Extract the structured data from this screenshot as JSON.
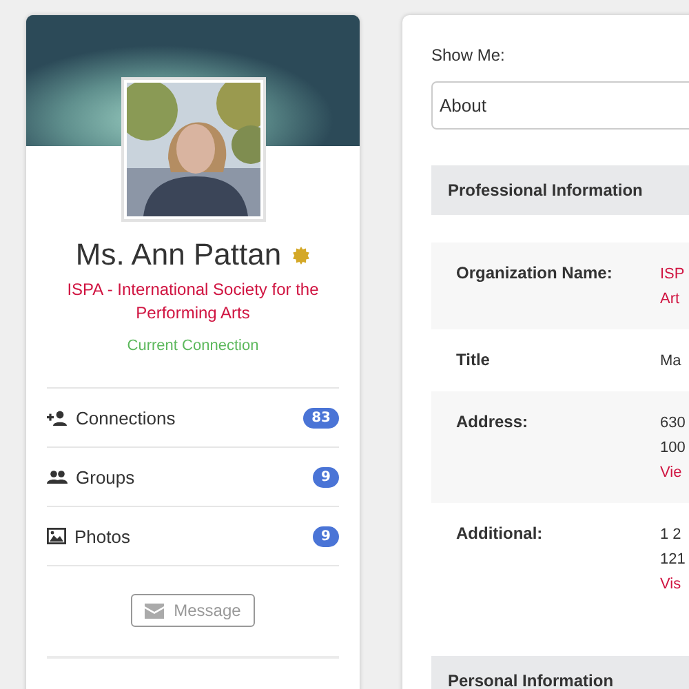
{
  "profile": {
    "name": "Ms. Ann Pattan",
    "organization": "ISPA - International Society for the Performing Arts",
    "status": "Current Connection"
  },
  "stats": [
    {
      "kind": "connections",
      "label": "Connections",
      "count": "83"
    },
    {
      "kind": "groups",
      "label": "Groups",
      "count": "9"
    },
    {
      "kind": "photos",
      "label": "Photos",
      "count": "9"
    }
  ],
  "message_button": "Message",
  "about": {
    "show_label": "Show Me:",
    "view_select": "About",
    "sections": [
      {
        "title": "Professional Information",
        "rows": [
          {
            "label": "Organization Name:",
            "lines": [
              {
                "kind": "link",
                "text": "ISP"
              },
              {
                "kind": "link",
                "text": "Art"
              }
            ]
          },
          {
            "label": "Title",
            "lines": [
              {
                "kind": "text",
                "text": "Ma"
              }
            ]
          },
          {
            "label": "Address:",
            "lines": [
              {
                "kind": "text",
                "text": "630"
              },
              {
                "kind": "text",
                "text": "100"
              },
              {
                "kind": "link",
                "text": "Vie"
              }
            ]
          },
          {
            "label": "Additional:",
            "lines": [
              {
                "kind": "text",
                "text": "1 2"
              },
              {
                "kind": "text",
                "text": "121"
              },
              {
                "kind": "link",
                "text": "Vis"
              }
            ]
          }
        ]
      },
      {
        "title": "Personal Information"
      }
    ]
  }
}
